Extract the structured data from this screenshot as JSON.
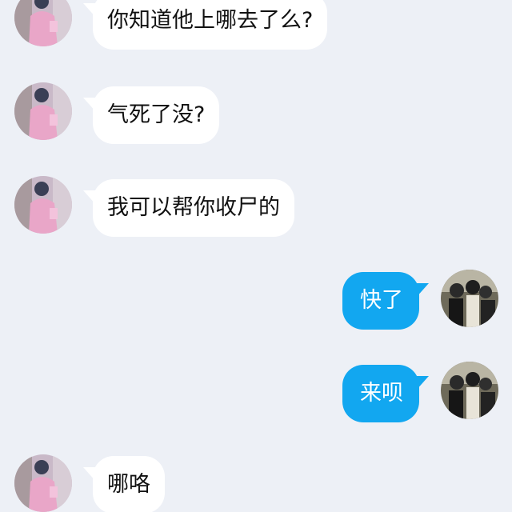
{
  "colors": {
    "background": "#edf0f6",
    "incoming_bubble": "#ffffff",
    "outgoing_bubble": "#12a7f0",
    "incoming_text": "#111111",
    "outgoing_text": "#ffffff"
  },
  "messages": [
    {
      "direction": "incoming",
      "sender": "other",
      "text": "你知道他上哪去了么?"
    },
    {
      "direction": "incoming",
      "sender": "other",
      "text": "气死了没?"
    },
    {
      "direction": "incoming",
      "sender": "other",
      "text": "我可以帮你收尸的"
    },
    {
      "direction": "outgoing",
      "sender": "me",
      "text": "快了"
    },
    {
      "direction": "outgoing",
      "sender": "me",
      "text": "来呗"
    },
    {
      "direction": "incoming",
      "sender": "other",
      "text": "哪咯"
    }
  ]
}
